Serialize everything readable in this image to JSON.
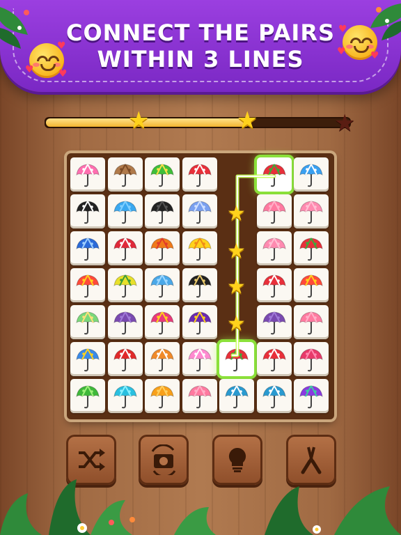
{
  "banner": {
    "line1": "CONNECT THE PAIRS",
    "line2": "WITHIN 3 LINES"
  },
  "progress": {
    "fraction": 0.67,
    "stars": [
      {
        "state": "earned"
      },
      {
        "state": "earned"
      },
      {
        "state": "locked"
      }
    ]
  },
  "colors": {
    "banner": "#8a34d6",
    "board": "#5a2f14",
    "highlight": "#8be03a",
    "star": "#ffd21c"
  },
  "board": {
    "rows": 7,
    "cols": 7,
    "tiles": [
      [
        "pink-dotted-umbrella",
        "bear-umbrella",
        "green-frog-umbrella",
        "red-dotted-umbrella",
        "empty",
        "watermelon-umbrella",
        "blue-cloud-umbrella"
      ],
      [
        "black-white-striped-umbrella",
        "blue-umbrella",
        "black-umbrella",
        "mouse-umbrella",
        "empty",
        "pink-umbrella",
        "pink-pig-umbrella"
      ],
      [
        "blue-striped-umbrella",
        "strawberry-umbrella",
        "orange-striped-umbrella",
        "yellow-chick-umbrella",
        "empty",
        "pink-pig-umbrella",
        "watermelon-umbrella"
      ],
      [
        "rainbow-umbrella",
        "lemon-umbrella",
        "blue-cat-umbrella",
        "black-gold-striped-umbrella",
        "empty",
        "red-dotted-umbrella",
        "rainbow-umbrella"
      ],
      [
        "green-striped-umbrella",
        "purple-umbrella",
        "pink-yellow-umbrella",
        "purple-dotted-umbrella",
        "empty",
        "purple-umbrella",
        "pink-umbrella"
      ],
      [
        "blue-yellow-umbrella",
        "red-white-umbrella",
        "fox-umbrella",
        "pink-bunny-umbrella",
        "watermelon-umbrella",
        "red-dotted-umbrella",
        "pink-red-umbrella"
      ],
      [
        "frog-umbrella",
        "cyan-umbrella",
        "orange-umbrella",
        "pink-umbrella",
        "shark-umbrella",
        "shark-umbrella",
        "rainbow-striped-umbrella"
      ]
    ],
    "highlighted": [
      [
        0,
        5
      ],
      [
        5,
        4
      ]
    ]
  },
  "toolbar": [
    {
      "name": "shuffle-button",
      "icon": "shuffle-icon"
    },
    {
      "name": "rotate-camera-button",
      "icon": "rotate-camera-icon"
    },
    {
      "name": "hint-button",
      "icon": "lightbulb-icon"
    },
    {
      "name": "pliers-button",
      "icon": "pliers-icon"
    }
  ]
}
